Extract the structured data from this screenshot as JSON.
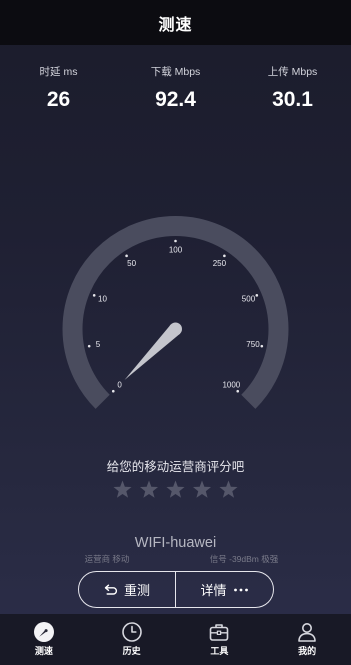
{
  "header": {
    "title": "测速"
  },
  "metrics": [
    {
      "label": "时延 ms",
      "value": "26"
    },
    {
      "label": "下载 Mbps",
      "value": "92.4"
    },
    {
      "label": "上传 Mbps",
      "value": "30.1"
    }
  ],
  "gauge": {
    "scale": [
      "0",
      "5",
      "10",
      "50",
      "100",
      "250",
      "500",
      "750",
      "1000"
    ],
    "needle_value": 0
  },
  "rating": {
    "prompt": "给您的移动运营商评分吧",
    "stars_total": 5,
    "stars_selected": 0
  },
  "network": {
    "ssid": "WIFI-huawei",
    "carrier": "运营商 移动",
    "signal": "信号 -39dBm 极强"
  },
  "actions": {
    "retest": {
      "label": "重测",
      "icon": "undo-arrow-icon"
    },
    "details": {
      "label": "详情",
      "icon": "more-dots-icon"
    }
  },
  "nav": [
    {
      "label": "测速",
      "icon": "speedometer-icon",
      "active": true
    },
    {
      "label": "历史",
      "icon": "clock-icon",
      "active": false
    },
    {
      "label": "工具",
      "icon": "toolbox-icon",
      "active": false
    },
    {
      "label": "我的",
      "icon": "person-icon",
      "active": false
    }
  ],
  "colors": {
    "header_bg": "#0c0c11",
    "background_top": "#1b1c2b",
    "background_bottom": "#2c2e4a",
    "gauge_arc": "#4a4c5e",
    "gauge_dot": "#e6e6ea",
    "gauge_label": "#e8e8ee",
    "needle": "#c4c5cc",
    "star_empty": "#55576a",
    "star_filled": "#f5c542",
    "nav_bg": "#181926",
    "text_primary": "#ffffff",
    "text_muted": "#7a7b8a"
  }
}
